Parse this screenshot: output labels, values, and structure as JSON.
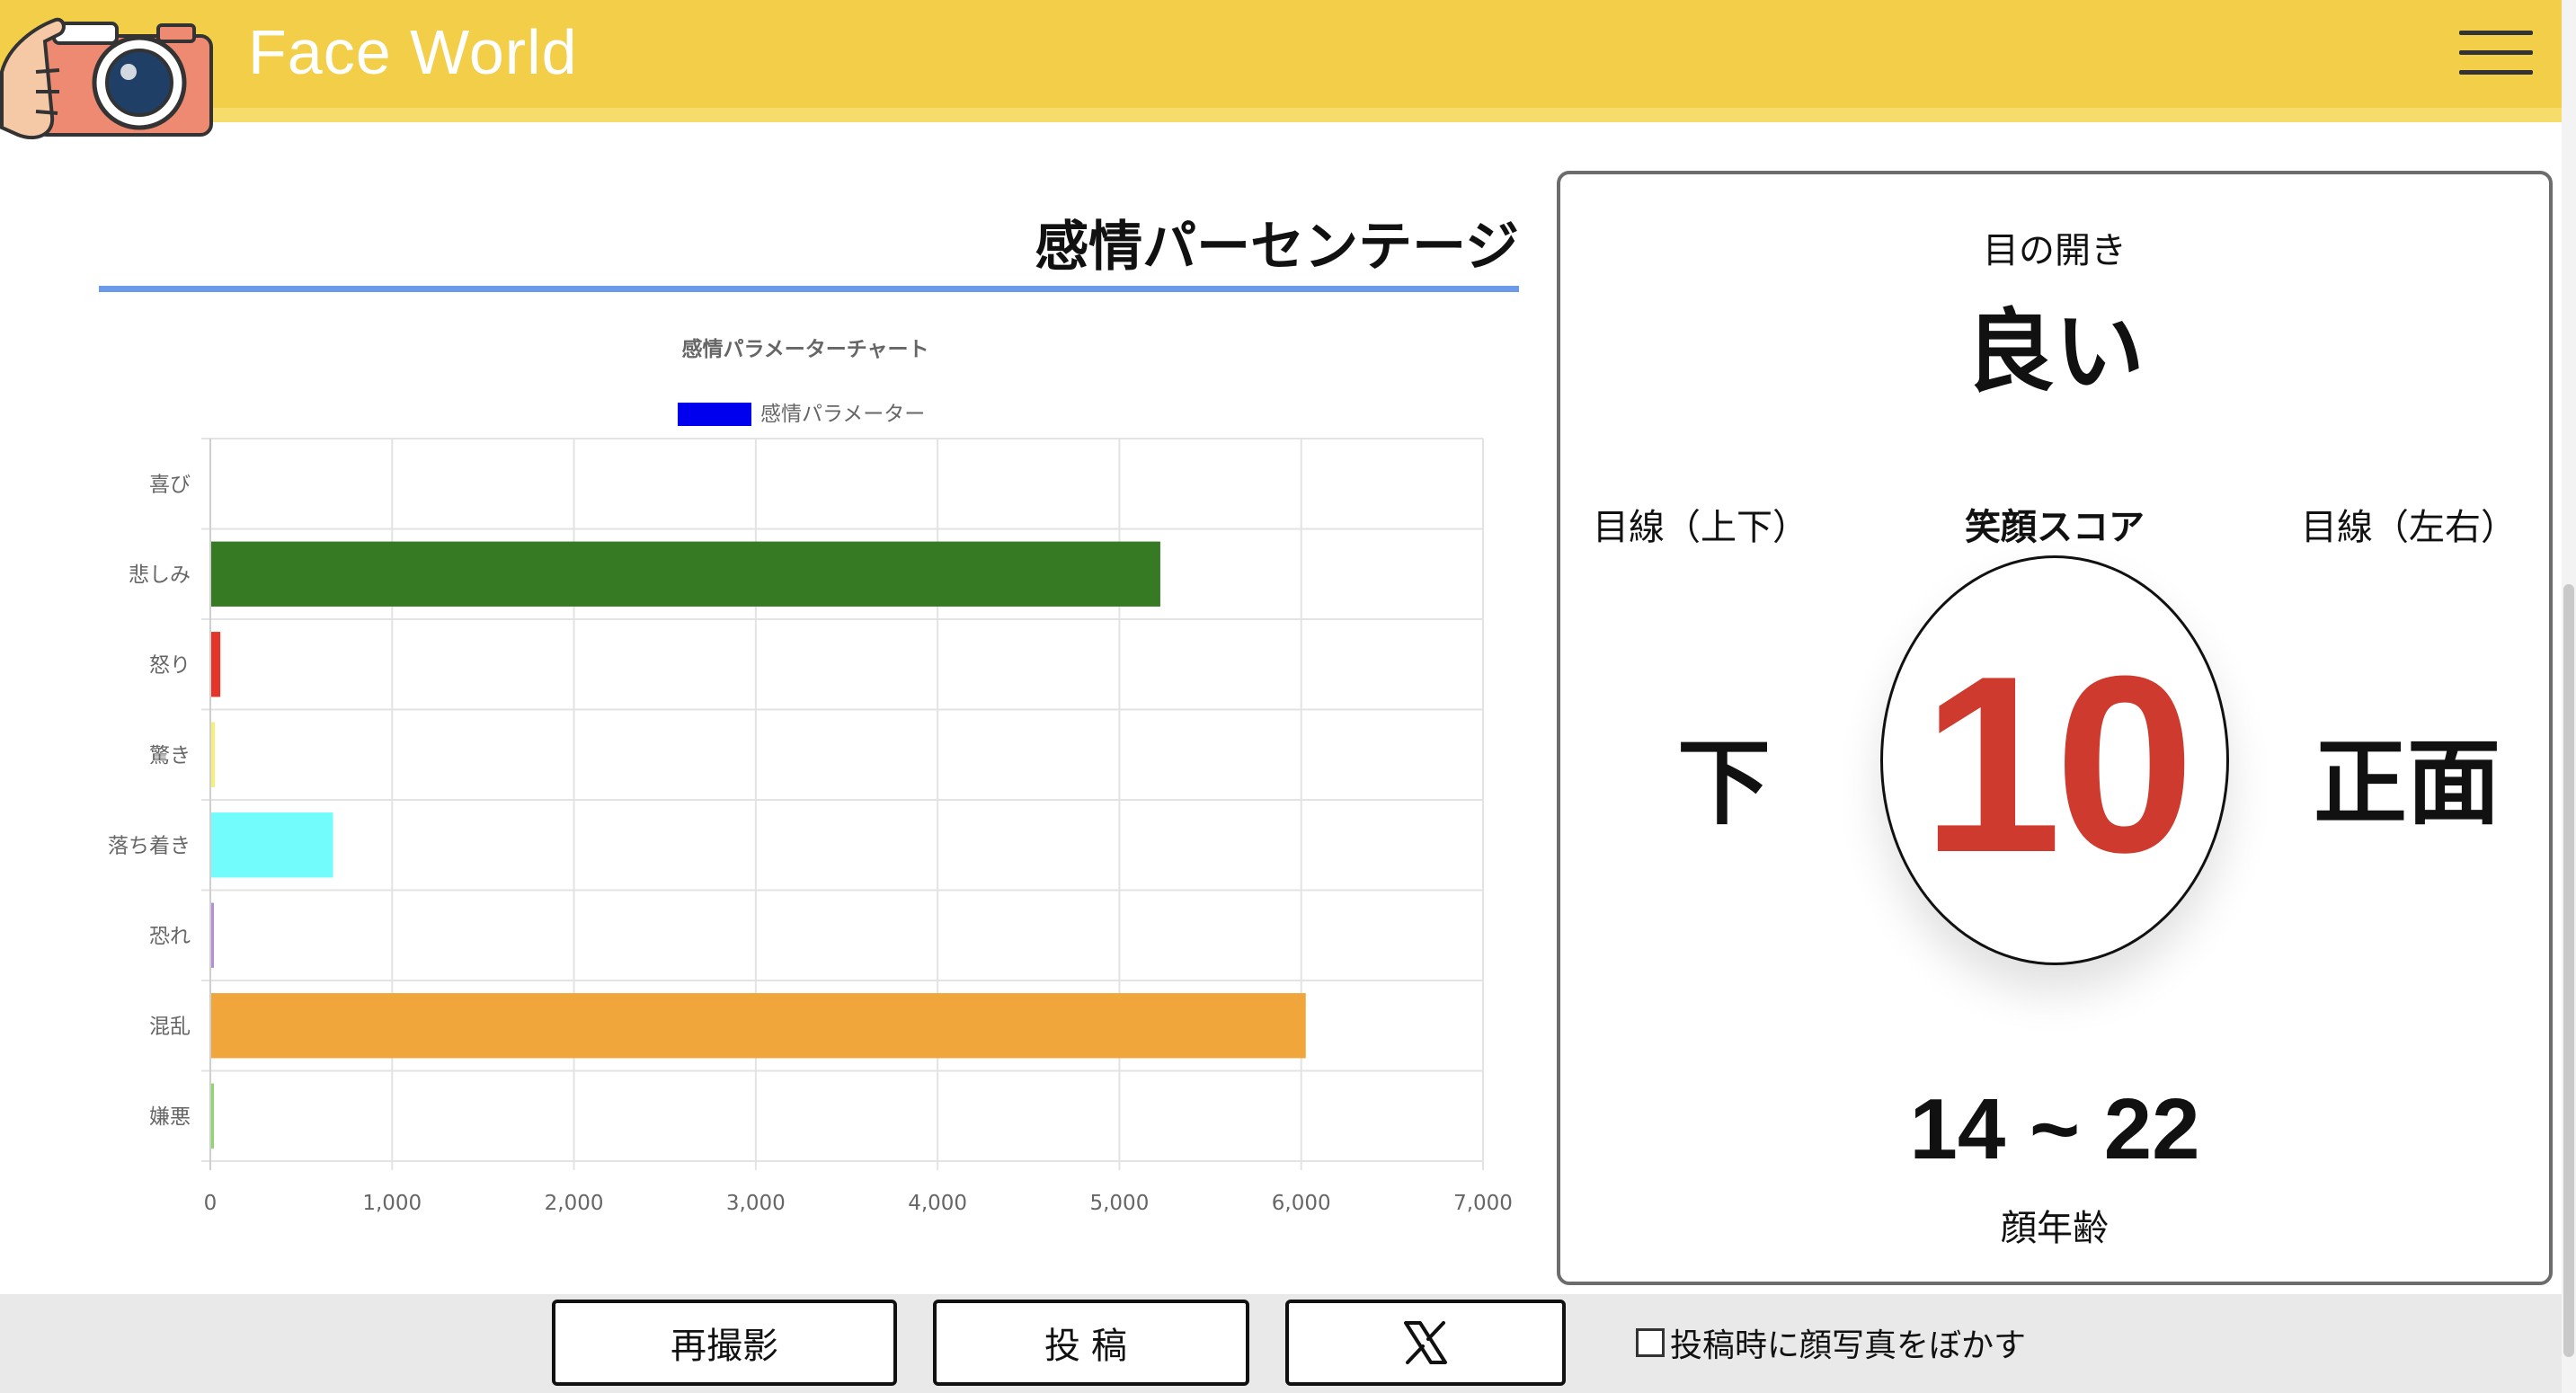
{
  "header": {
    "app_title": "Face World",
    "logo_icon": "camera-icon",
    "menu_icon": "hamburger-menu-icon",
    "background_color": "#f3cf49"
  },
  "emotion_section": {
    "title": "感情パーセンテージ"
  },
  "chart_data": {
    "type": "bar",
    "orientation": "horizontal",
    "title": "感情パラメーターチャート",
    "legend": {
      "label": "感情パラメーター",
      "color": "#0000ee",
      "position": "top"
    },
    "categories": [
      "喜び",
      "悲しみ",
      "怒り",
      "驚き",
      "落ち着き",
      "恐れ",
      "混乱",
      "嫌悪"
    ],
    "values": [
      0,
      5220,
      50,
      20,
      670,
      5,
      6020,
      15
    ],
    "colors": [
      "#f0a0c0",
      "#367b24",
      "#e5352b",
      "#f6f07a",
      "#72fcfc",
      "#b48fd8",
      "#f0a63a",
      "#8ed66d"
    ],
    "xlim": [
      0,
      7000
    ],
    "x_ticks": [
      "0",
      "1,000",
      "2,000",
      "3,000",
      "4,000",
      "5,000",
      "6,000",
      "7,000"
    ],
    "grid": true
  },
  "panel": {
    "eye_open_label": "目の開き",
    "eye_open_value": "良い",
    "gaze_vertical_label": "目線（上下）",
    "gaze_vertical_value": "下",
    "smile_score_label": "笑顔スコア",
    "smile_score_value": "10",
    "gaze_horizontal_label": "目線（左右）",
    "gaze_horizontal_value": "正面",
    "face_age_value": "14 ~ 22",
    "face_age_label": "顔年齢",
    "score_color": "#cf3a2f"
  },
  "footer": {
    "retake_label": "再撮影",
    "post_label": "投稿",
    "x_share_icon": "x-logo-icon",
    "blur_checkbox_label": "投稿時に顔写真をぼかす",
    "blur_checked": false
  }
}
